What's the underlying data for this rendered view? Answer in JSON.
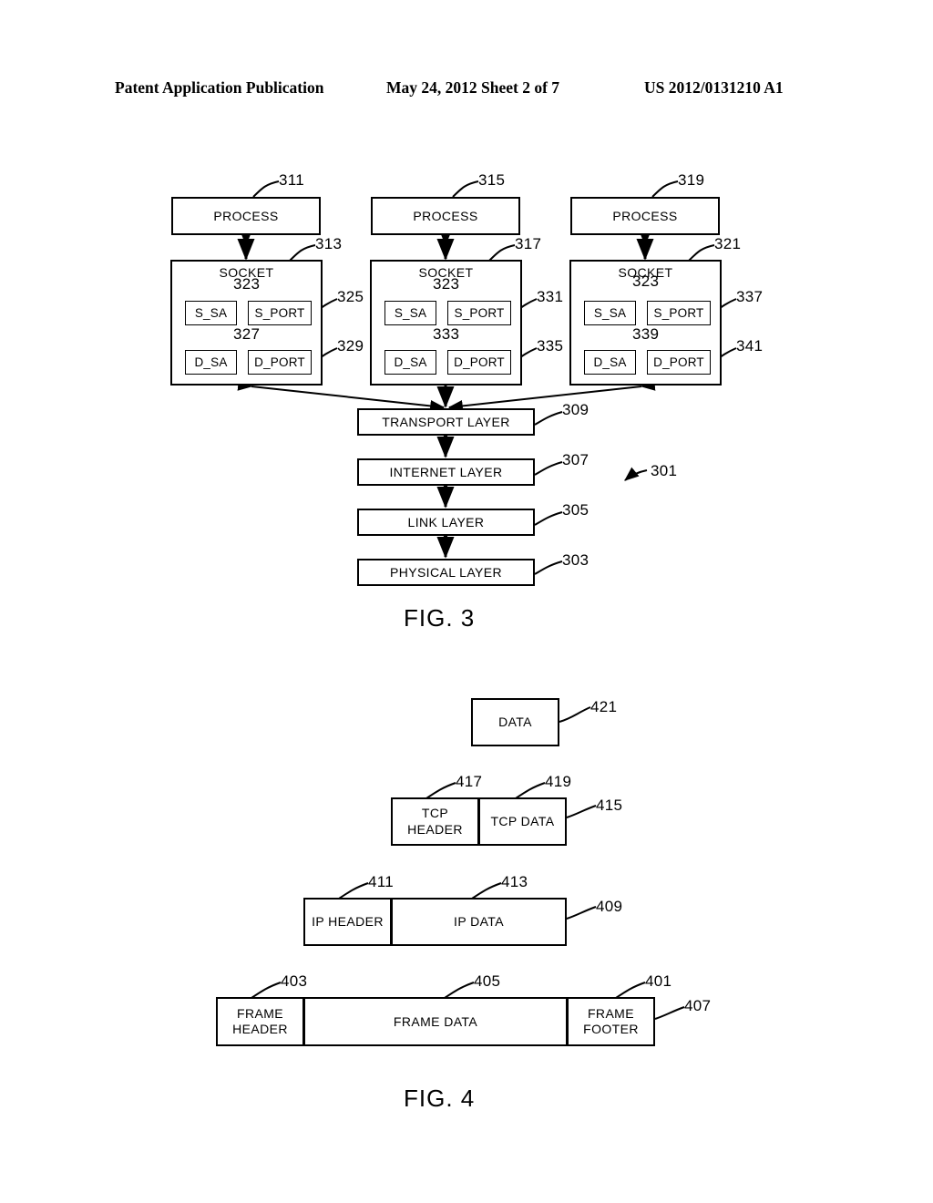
{
  "header": {
    "left": "Patent Application Publication",
    "middle": "May 24, 2012  Sheet 2 of 7",
    "right": "US 2012/0131210 A1"
  },
  "figures": [
    {
      "caption": "FIG. 3",
      "diagram_ref": "301"
    },
    {
      "caption": "FIG. 4"
    }
  ],
  "fig3": {
    "caption": "FIG. 3",
    "diagram_ref": "301",
    "columns": [
      {
        "process_label": "PROCESS",
        "process_ref": "311",
        "socket_label": "SOCKET",
        "socket_ref": "313",
        "fields": [
          {
            "label": "S_SA",
            "ref": "323"
          },
          {
            "label": "S_PORT",
            "ref": "325"
          },
          {
            "label": "D_SA",
            "ref": "327"
          },
          {
            "label": "D_PORT",
            "ref": "329"
          }
        ]
      },
      {
        "process_label": "PROCESS",
        "process_ref": "315",
        "socket_label": "SOCKET",
        "socket_ref": "317",
        "fields": [
          {
            "label": "S_SA",
            "ref": "323"
          },
          {
            "label": "S_PORT",
            "ref": "331"
          },
          {
            "label": "D_SA",
            "ref": "333"
          },
          {
            "label": "D_PORT",
            "ref": "335"
          }
        ]
      },
      {
        "process_label": "PROCESS",
        "process_ref": "319",
        "socket_label": "SOCKET",
        "socket_ref": "321",
        "fields": [
          {
            "label": "S_SA",
            "ref": "323"
          },
          {
            "label": "S_PORT",
            "ref": "337"
          },
          {
            "label": "D_SA",
            "ref": "339"
          },
          {
            "label": "D_PORT",
            "ref": "341"
          }
        ]
      }
    ],
    "layers": [
      {
        "label": "TRANSPORT  LAYER",
        "ref": "309"
      },
      {
        "label": "INTERNET  LAYER",
        "ref": "307"
      },
      {
        "label": "LINK LAYER",
        "ref": "305"
      },
      {
        "label": "PHYSICAL  LAYER",
        "ref": "303"
      }
    ]
  },
  "fig4": {
    "caption": "FIG. 4",
    "rows": [
      {
        "row_ref": "421",
        "cells": [
          {
            "label": "DATA",
            "ref": null
          }
        ]
      },
      {
        "row_ref": "415",
        "cells": [
          {
            "label": "TCP HEADER",
            "ref": "417"
          },
          {
            "label": "TCP DATA",
            "ref": "419"
          }
        ]
      },
      {
        "row_ref": "409",
        "cells": [
          {
            "label": "IP HEADER",
            "ref": "411"
          },
          {
            "label": "IP DATA",
            "ref": "413"
          }
        ]
      },
      {
        "row_ref": "407",
        "cells": [
          {
            "label": "FRAME HEADER",
            "ref": "403"
          },
          {
            "label": "FRAME DATA",
            "ref": "405"
          },
          {
            "label": "FRAME FOOTER",
            "ref": "401"
          }
        ]
      }
    ],
    "cell_text": {
      "data": "DATA",
      "tcp_header_line1": "TCP",
      "tcp_header_line2": "HEADER",
      "tcp_data": "TCP DATA",
      "ip_header": "IP HEADER",
      "ip_data": "IP DATA",
      "frame_header_line1": "FRAME",
      "frame_header_line2": "HEADER",
      "frame_data": "FRAME DATA",
      "frame_footer_line1": "FRAME",
      "frame_footer_line2": "FOOTER"
    }
  },
  "colors": {
    "ink": "#000000",
    "paper": "#ffffff"
  }
}
